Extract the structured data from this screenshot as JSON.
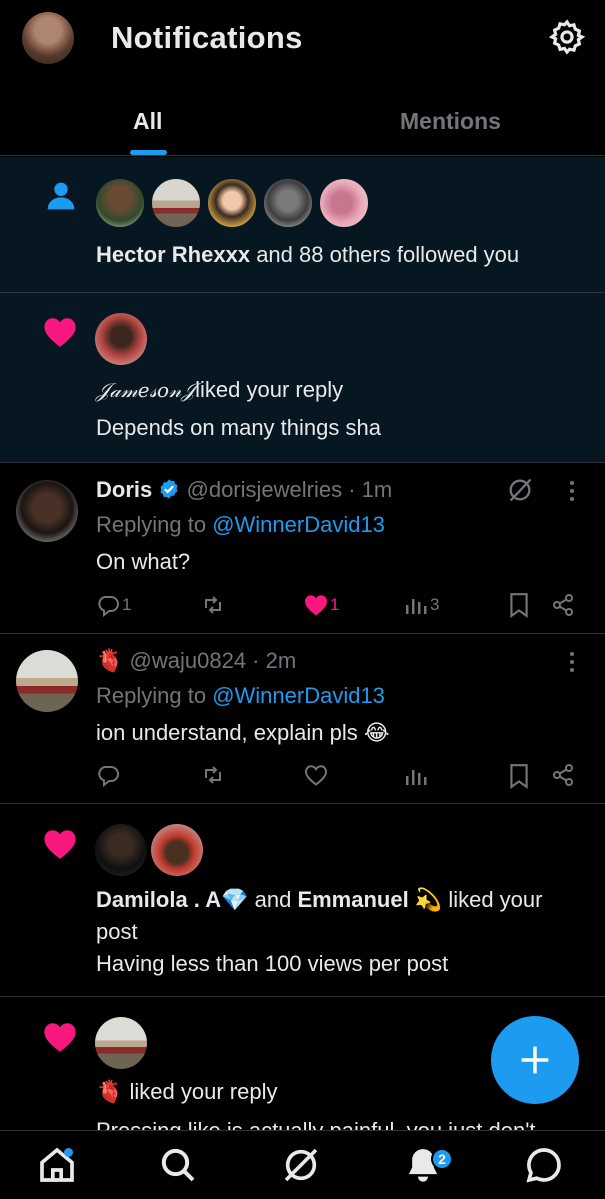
{
  "header": {
    "title": "Notifications"
  },
  "tabs": [
    {
      "label": "All"
    },
    {
      "label": "Mentions"
    }
  ],
  "notifications": {
    "follow": {
      "actor": "Hector Rhexxx",
      "rest": " and 88 others followed you"
    },
    "like_reply": {
      "actor": "𝒥𝒶𝓂𝑒𝓈𝑜𝓃𝒥",
      "rest": "liked your reply",
      "snippet": "Depends on many things sha"
    },
    "tweet1": {
      "name": "Doris",
      "handle": "@dorisjewelries",
      "time": " · 1m",
      "replying_prefix": "Replying to ",
      "replying_to": "@WinnerDavid13",
      "body": "On what?",
      "replies": "1",
      "likes": "1",
      "views": "3"
    },
    "tweet2": {
      "name_emoji": "🫀",
      "handle": "@waju0824",
      "time": " · 2m",
      "replying_prefix": "Replying to ",
      "replying_to": "@WinnerDavid13",
      "body": "ion understand, explain pls 😂"
    },
    "like_post": {
      "actor1": "Damilola . A💎",
      "and": " and ",
      "actor2": "Emmanuel 💫",
      "rest": " liked your",
      "rest2": "post",
      "snippet": "Having less than 100 views per post"
    },
    "like_reply2": {
      "actor": "🫀",
      "rest": " liked your reply",
      "snippet": "Pressing like is actually painful, you just don't"
    }
  },
  "bottom_nav": {
    "badge_count": "2"
  },
  "colors": {
    "accent": "#1d9bf0",
    "like": "#f91880",
    "unread_bg": "#061722"
  }
}
